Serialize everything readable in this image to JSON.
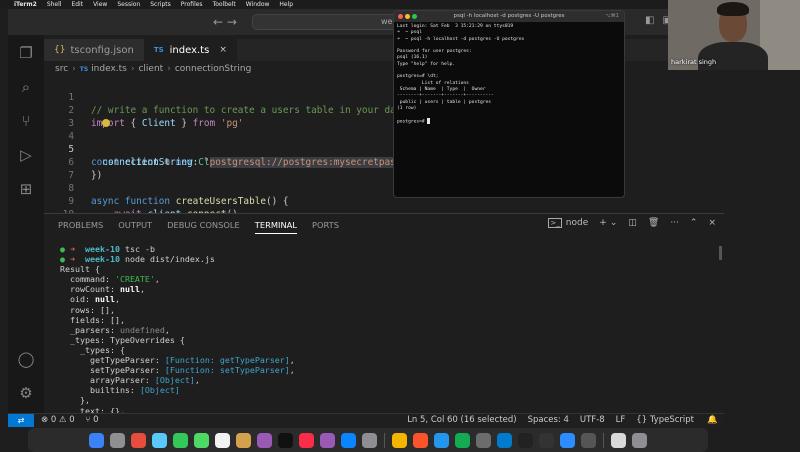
{
  "menubar": {
    "apple": "",
    "items": [
      "iTerm2",
      "Shell",
      "Edit",
      "View",
      "Session",
      "Scripts",
      "Profiles",
      "Toolbelt",
      "Window",
      "Help"
    ]
  },
  "vscode": {
    "nav": "← →",
    "command_center": "wee",
    "tabs": [
      {
        "label": "tsconfig.json",
        "active": false
      },
      {
        "label": "index.ts",
        "active": true,
        "badge": "TS"
      }
    ],
    "tab_close": "×",
    "breadcrumb": {
      "folder": "src",
      "file_badge": "TS",
      "file": "index.ts",
      "symbol1": "client",
      "symbol2": "connectionString"
    },
    "line_numbers": [
      "1",
      "2",
      "3",
      "4",
      "5",
      "6",
      "7",
      "8",
      "9",
      "10"
    ],
    "code": {
      "l1": "// write a function to create a users table in your database.",
      "l2_import": "import",
      "l2_open": " { ",
      "l2_client": "Client",
      "l2_close": " } ",
      "l2_from": "from",
      "l2_str": " 'pg'",
      "l4_const": "const",
      "l4_client": " client",
      "l4_eq": " = ",
      "l4_new": "new",
      "l4_cls": " Client",
      "l4_paren": "({",
      "l5_key": "connectionString",
      "l5_colon": ": ",
      "l5_q": "\"",
      "l5_sel": "postgresql://postgres:mysecretpassword@localhost/postgres",
      "l6": "})",
      "l8_async": "async",
      "l8_function": " function",
      "l8_name": " createUsersTable",
      "l8_rest": "() {",
      "l9_await": "await",
      "l9_client": " client",
      "l9_dot": ".",
      "l9_fn": "connect",
      "l9_rest": "()",
      "l10_const": "const",
      "l10_result": " result",
      "l10_eq": " = ",
      "l10_await": "await",
      "l10_client": " client",
      "l10_dot": ".",
      "l10_fn": "query",
      "l10_rest": "(`"
    }
  },
  "panel": {
    "tabs": [
      "PROBLEMS",
      "OUTPUT",
      "DEBUG CONSOLE",
      "TERMINAL",
      "PORTS"
    ],
    "active_tab": "TERMINAL",
    "terminal_name": "node",
    "terminal": {
      "prompt_dir": "week-10",
      "cmd1": "tsc -b",
      "cmd2": "node dist/index.js",
      "lines": {
        "result": "Result {",
        "command_key": "  command: ",
        "command_val": "'CREATE'",
        "rowcount_key": "  rowCount: ",
        "rowcount_val": "null",
        "oid_key": "  oid: ",
        "oid_val": "null",
        "rows": "  rows: [],",
        "fields": "  fields: [],",
        "parsers_key": "  _parsers: ",
        "parsers_val": "undefined",
        "types": "  _types: TypeOverrides {",
        "types_inner": "    _types: {",
        "gtp_key": "      getTypeParser: ",
        "gtp_val": "[Function: getTypeParser]",
        "stp_key": "      setTypeParser: ",
        "stp_val": "[Function: setTypeParser]",
        "ap_key": "      arrayParser: ",
        "ap_val": "[Object]",
        "bi_key": "      builtins: ",
        "bi_val": "[Object]",
        "close": "    },",
        "text": "    text: {},"
      }
    }
  },
  "statusbar": {
    "remote": "⇄",
    "problems": "⊗ 0 ⚠ 0",
    "ports": "⑂ 0",
    "position": "Ln 5, Col 60 (16 selected)",
    "spaces": "Spaces: 4",
    "encoding": "UTF-8",
    "eol": "LF",
    "language": "{} TypeScript",
    "bell": "🔔"
  },
  "psql": {
    "title": "psql -h localhost -d postgres -U postgres",
    "shortcut": "⌥⌘1",
    "lines": [
      "Last login: Sat Feb  3 15:21:29 on ttys019",
      "➜  ~ psql",
      "➜  ~ psql -h localhost -d postgres -U postgres",
      "",
      "Password for user postgres:",
      "psql (16.1)",
      "Type \"help\" for help.",
      "",
      "postgres=# \\dt;",
      "         List of relations",
      " Schema | Name  | Type  |  Owner",
      "--------+-------+-------+----------",
      " public | users | table | postgres",
      "(1 row)",
      "",
      "postgres=# "
    ]
  },
  "webcam": {
    "name": "harkirat singh"
  }
}
